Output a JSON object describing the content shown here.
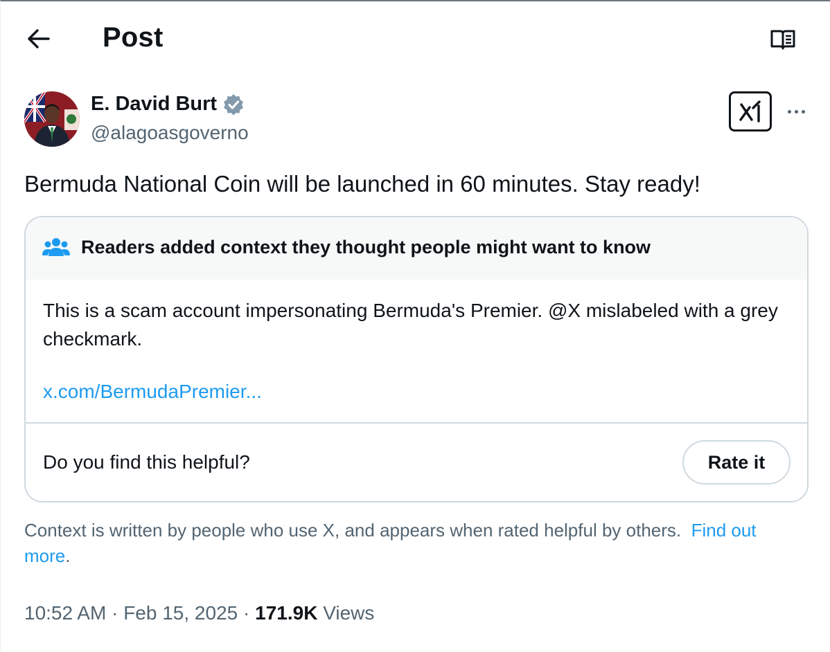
{
  "header": {
    "title": "Post",
    "back_icon": "arrow-left-icon",
    "reader_icon": "reader-mode-icon"
  },
  "author": {
    "name": "E. David Burt",
    "handle": "@alagoasgoverno",
    "verified_badge_color": "#829aab"
  },
  "post": {
    "text": "Bermuda National Coin will be launched in 60 minutes. Stay ready!"
  },
  "community_note": {
    "title": "Readers added context they thought people might want to know",
    "text": "This is a scam account impersonating Bermuda's Premier. @X mislabeled with a grey checkmark.",
    "link": "x.com/BermudaPremier...",
    "helpful_question": "Do you find this helpful?",
    "rate_label": "Rate it",
    "footer_text": "Context is written by people who use X, and appears when rated helpful by others.",
    "footer_link": "Find out more",
    "footer_end": "."
  },
  "meta": {
    "time": "10:52 AM",
    "separator": " · ",
    "date": "Feb 15, 2025",
    "views_count": "171.9K",
    "views_label": "Views"
  },
  "colors": {
    "accent": "#1d9bf0",
    "text": "#0f1419",
    "secondary": "#536471",
    "border": "#cfd9de"
  }
}
